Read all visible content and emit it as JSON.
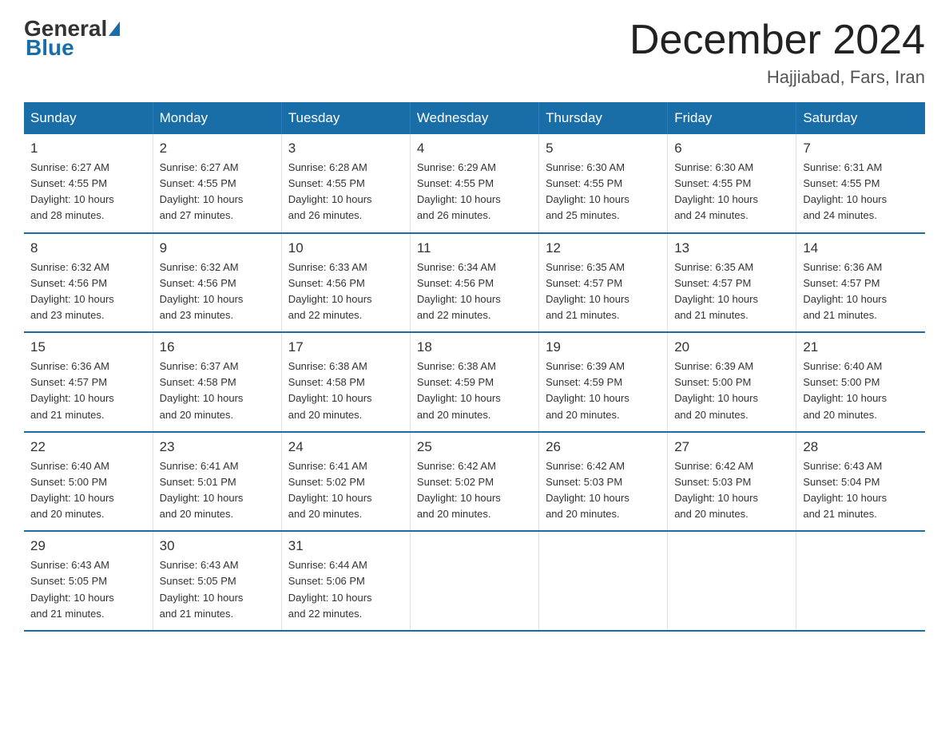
{
  "header": {
    "logo_general": "General",
    "logo_blue": "Blue",
    "month_title": "December 2024",
    "location": "Hajjiabad, Fars, Iran"
  },
  "days_of_week": [
    "Sunday",
    "Monday",
    "Tuesday",
    "Wednesday",
    "Thursday",
    "Friday",
    "Saturday"
  ],
  "weeks": [
    [
      {
        "day": "1",
        "sunrise": "6:27 AM",
        "sunset": "4:55 PM",
        "daylight": "10 hours and 28 minutes."
      },
      {
        "day": "2",
        "sunrise": "6:27 AM",
        "sunset": "4:55 PM",
        "daylight": "10 hours and 27 minutes."
      },
      {
        "day": "3",
        "sunrise": "6:28 AM",
        "sunset": "4:55 PM",
        "daylight": "10 hours and 26 minutes."
      },
      {
        "day": "4",
        "sunrise": "6:29 AM",
        "sunset": "4:55 PM",
        "daylight": "10 hours and 26 minutes."
      },
      {
        "day": "5",
        "sunrise": "6:30 AM",
        "sunset": "4:55 PM",
        "daylight": "10 hours and 25 minutes."
      },
      {
        "day": "6",
        "sunrise": "6:30 AM",
        "sunset": "4:55 PM",
        "daylight": "10 hours and 24 minutes."
      },
      {
        "day": "7",
        "sunrise": "6:31 AM",
        "sunset": "4:55 PM",
        "daylight": "10 hours and 24 minutes."
      }
    ],
    [
      {
        "day": "8",
        "sunrise": "6:32 AM",
        "sunset": "4:56 PM",
        "daylight": "10 hours and 23 minutes."
      },
      {
        "day": "9",
        "sunrise": "6:32 AM",
        "sunset": "4:56 PM",
        "daylight": "10 hours and 23 minutes."
      },
      {
        "day": "10",
        "sunrise": "6:33 AM",
        "sunset": "4:56 PM",
        "daylight": "10 hours and 22 minutes."
      },
      {
        "day": "11",
        "sunrise": "6:34 AM",
        "sunset": "4:56 PM",
        "daylight": "10 hours and 22 minutes."
      },
      {
        "day": "12",
        "sunrise": "6:35 AM",
        "sunset": "4:57 PM",
        "daylight": "10 hours and 21 minutes."
      },
      {
        "day": "13",
        "sunrise": "6:35 AM",
        "sunset": "4:57 PM",
        "daylight": "10 hours and 21 minutes."
      },
      {
        "day": "14",
        "sunrise": "6:36 AM",
        "sunset": "4:57 PM",
        "daylight": "10 hours and 21 minutes."
      }
    ],
    [
      {
        "day": "15",
        "sunrise": "6:36 AM",
        "sunset": "4:57 PM",
        "daylight": "10 hours and 21 minutes."
      },
      {
        "day": "16",
        "sunrise": "6:37 AM",
        "sunset": "4:58 PM",
        "daylight": "10 hours and 20 minutes."
      },
      {
        "day": "17",
        "sunrise": "6:38 AM",
        "sunset": "4:58 PM",
        "daylight": "10 hours and 20 minutes."
      },
      {
        "day": "18",
        "sunrise": "6:38 AM",
        "sunset": "4:59 PM",
        "daylight": "10 hours and 20 minutes."
      },
      {
        "day": "19",
        "sunrise": "6:39 AM",
        "sunset": "4:59 PM",
        "daylight": "10 hours and 20 minutes."
      },
      {
        "day": "20",
        "sunrise": "6:39 AM",
        "sunset": "5:00 PM",
        "daylight": "10 hours and 20 minutes."
      },
      {
        "day": "21",
        "sunrise": "6:40 AM",
        "sunset": "5:00 PM",
        "daylight": "10 hours and 20 minutes."
      }
    ],
    [
      {
        "day": "22",
        "sunrise": "6:40 AM",
        "sunset": "5:00 PM",
        "daylight": "10 hours and 20 minutes."
      },
      {
        "day": "23",
        "sunrise": "6:41 AM",
        "sunset": "5:01 PM",
        "daylight": "10 hours and 20 minutes."
      },
      {
        "day": "24",
        "sunrise": "6:41 AM",
        "sunset": "5:02 PM",
        "daylight": "10 hours and 20 minutes."
      },
      {
        "day": "25",
        "sunrise": "6:42 AM",
        "sunset": "5:02 PM",
        "daylight": "10 hours and 20 minutes."
      },
      {
        "day": "26",
        "sunrise": "6:42 AM",
        "sunset": "5:03 PM",
        "daylight": "10 hours and 20 minutes."
      },
      {
        "day": "27",
        "sunrise": "6:42 AM",
        "sunset": "5:03 PM",
        "daylight": "10 hours and 20 minutes."
      },
      {
        "day": "28",
        "sunrise": "6:43 AM",
        "sunset": "5:04 PM",
        "daylight": "10 hours and 21 minutes."
      }
    ],
    [
      {
        "day": "29",
        "sunrise": "6:43 AM",
        "sunset": "5:05 PM",
        "daylight": "10 hours and 21 minutes."
      },
      {
        "day": "30",
        "sunrise": "6:43 AM",
        "sunset": "5:05 PM",
        "daylight": "10 hours and 21 minutes."
      },
      {
        "day": "31",
        "sunrise": "6:44 AM",
        "sunset": "5:06 PM",
        "daylight": "10 hours and 22 minutes."
      },
      {
        "day": "",
        "sunrise": "",
        "sunset": "",
        "daylight": ""
      },
      {
        "day": "",
        "sunrise": "",
        "sunset": "",
        "daylight": ""
      },
      {
        "day": "",
        "sunrise": "",
        "sunset": "",
        "daylight": ""
      },
      {
        "day": "",
        "sunrise": "",
        "sunset": "",
        "daylight": ""
      }
    ]
  ],
  "labels": {
    "sunrise": "Sunrise:",
    "sunset": "Sunset:",
    "daylight": "Daylight:"
  }
}
